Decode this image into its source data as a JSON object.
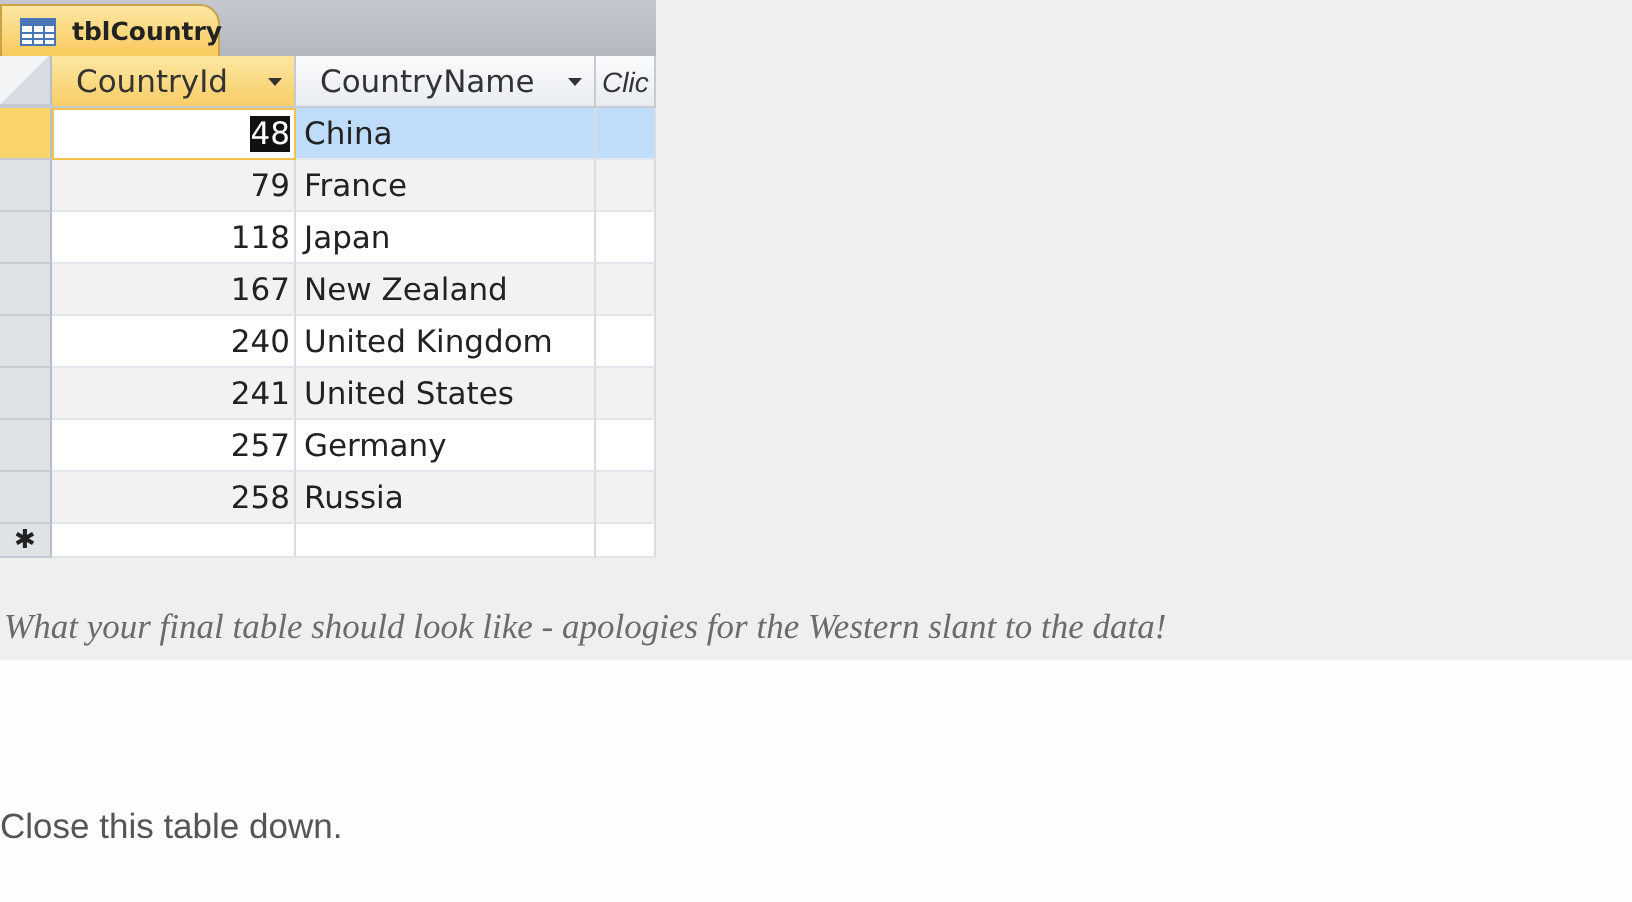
{
  "tab": {
    "title": "tblCountry"
  },
  "columns": [
    {
      "label": "CountryId",
      "selected": true,
      "dropdown": true
    },
    {
      "label": "CountryName",
      "selected": false,
      "dropdown": true
    },
    {
      "label": "Clic",
      "selected": false,
      "dropdown": false
    }
  ],
  "rows": [
    {
      "id": "48",
      "name": "China",
      "selected": true
    },
    {
      "id": "79",
      "name": "France",
      "selected": false
    },
    {
      "id": "118",
      "name": "Japan",
      "selected": false
    },
    {
      "id": "167",
      "name": "New Zealand",
      "selected": false
    },
    {
      "id": "240",
      "name": "United Kingdom",
      "selected": false
    },
    {
      "id": "241",
      "name": "United States",
      "selected": false
    },
    {
      "id": "257",
      "name": "Germany",
      "selected": false
    },
    {
      "id": "258",
      "name": "Russia",
      "selected": false
    }
  ],
  "new_row_marker": "✱",
  "caption": "What your final table should look like - apologies for the Western slant to the data!",
  "instruction": "Close this table down."
}
